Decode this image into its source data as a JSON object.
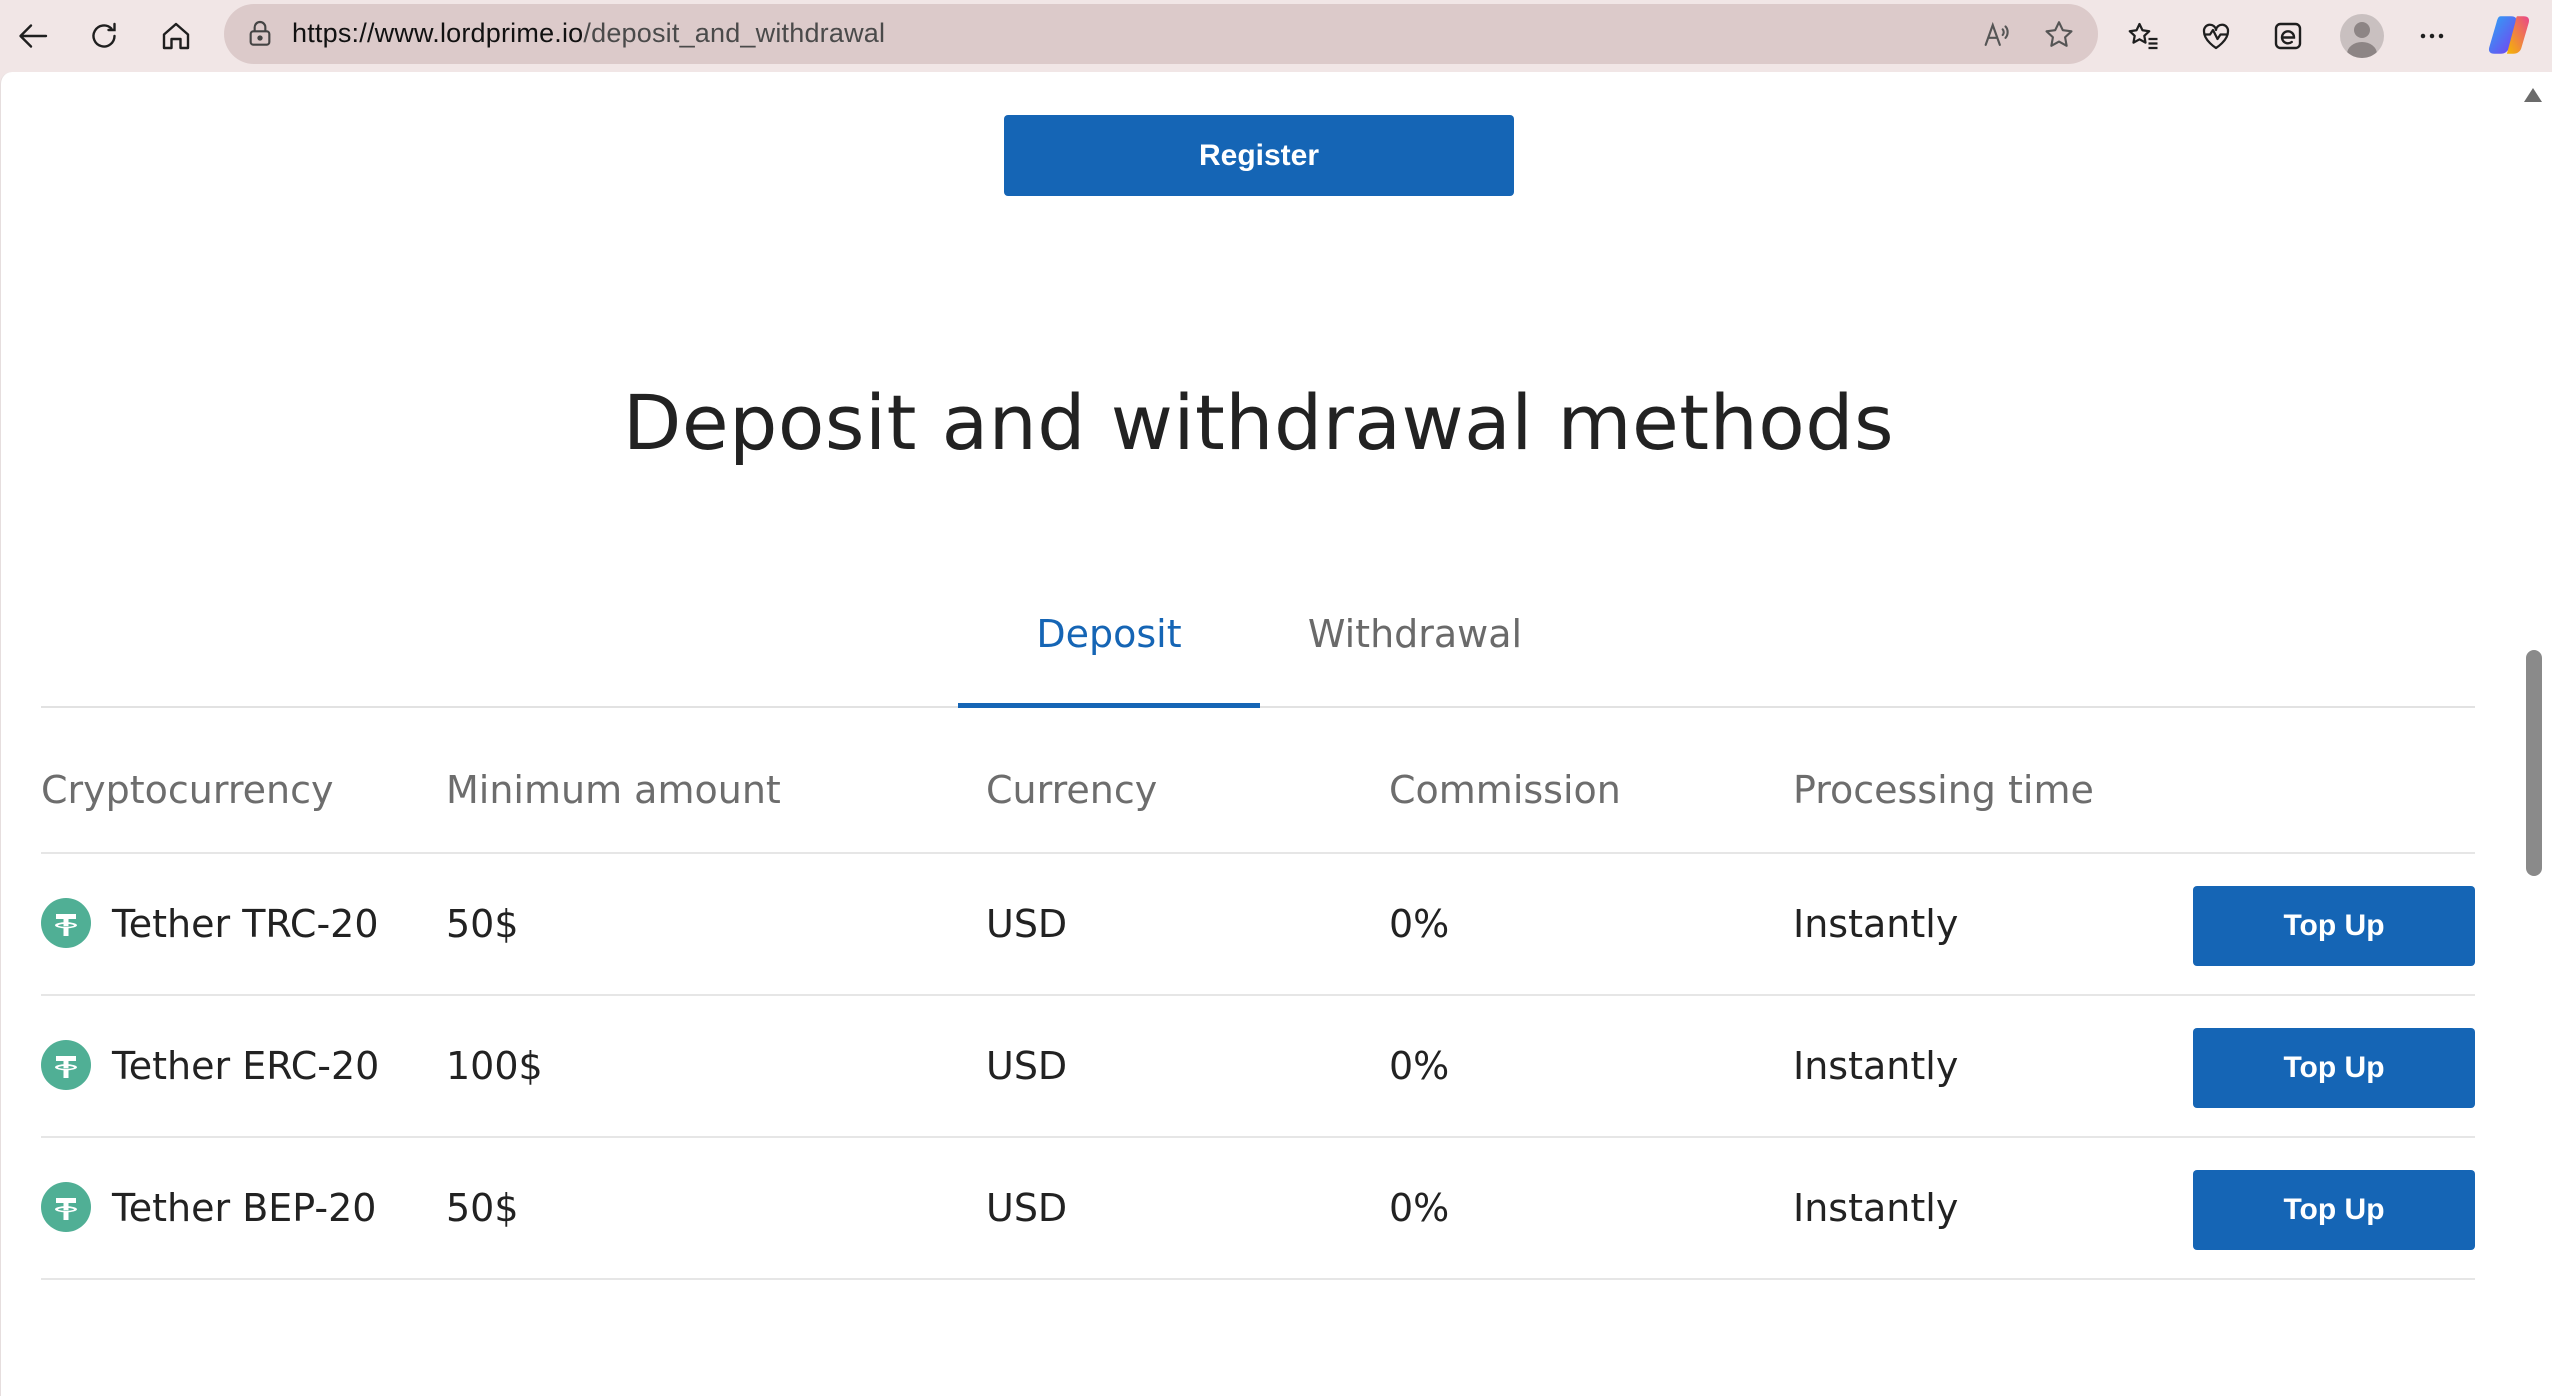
{
  "browser": {
    "url_host": "https://www.lordprime.io",
    "url_path": "/deposit_and_withdrawal"
  },
  "page": {
    "register_label": "Register",
    "title": "Deposit and withdrawal methods",
    "tabs": [
      {
        "label": "Deposit",
        "active": true
      },
      {
        "label": "Withdrawal",
        "active": false
      }
    ],
    "columns": [
      "Cryptocurrency",
      "Minimum amount",
      "Currency",
      "Commission",
      "Processing time"
    ],
    "rows": [
      {
        "name": "Tether TRC-20",
        "min": "50$",
        "currency": "USD",
        "commission": "0%",
        "time": "Instantly",
        "action": "Top Up",
        "icon": "tether-icon"
      },
      {
        "name": "Tether ERC-20",
        "min": "100$",
        "currency": "USD",
        "commission": "0%",
        "time": "Instantly",
        "action": "Top Up",
        "icon": "tether-icon"
      },
      {
        "name": "Tether BEP-20",
        "min": "50$",
        "currency": "USD",
        "commission": "0%",
        "time": "Instantly",
        "action": "Top Up",
        "icon": "tether-icon"
      }
    ]
  },
  "colors": {
    "accent": "#1565b5",
    "tether": "#50af95",
    "chrome_bg": "#f1e6e6"
  }
}
